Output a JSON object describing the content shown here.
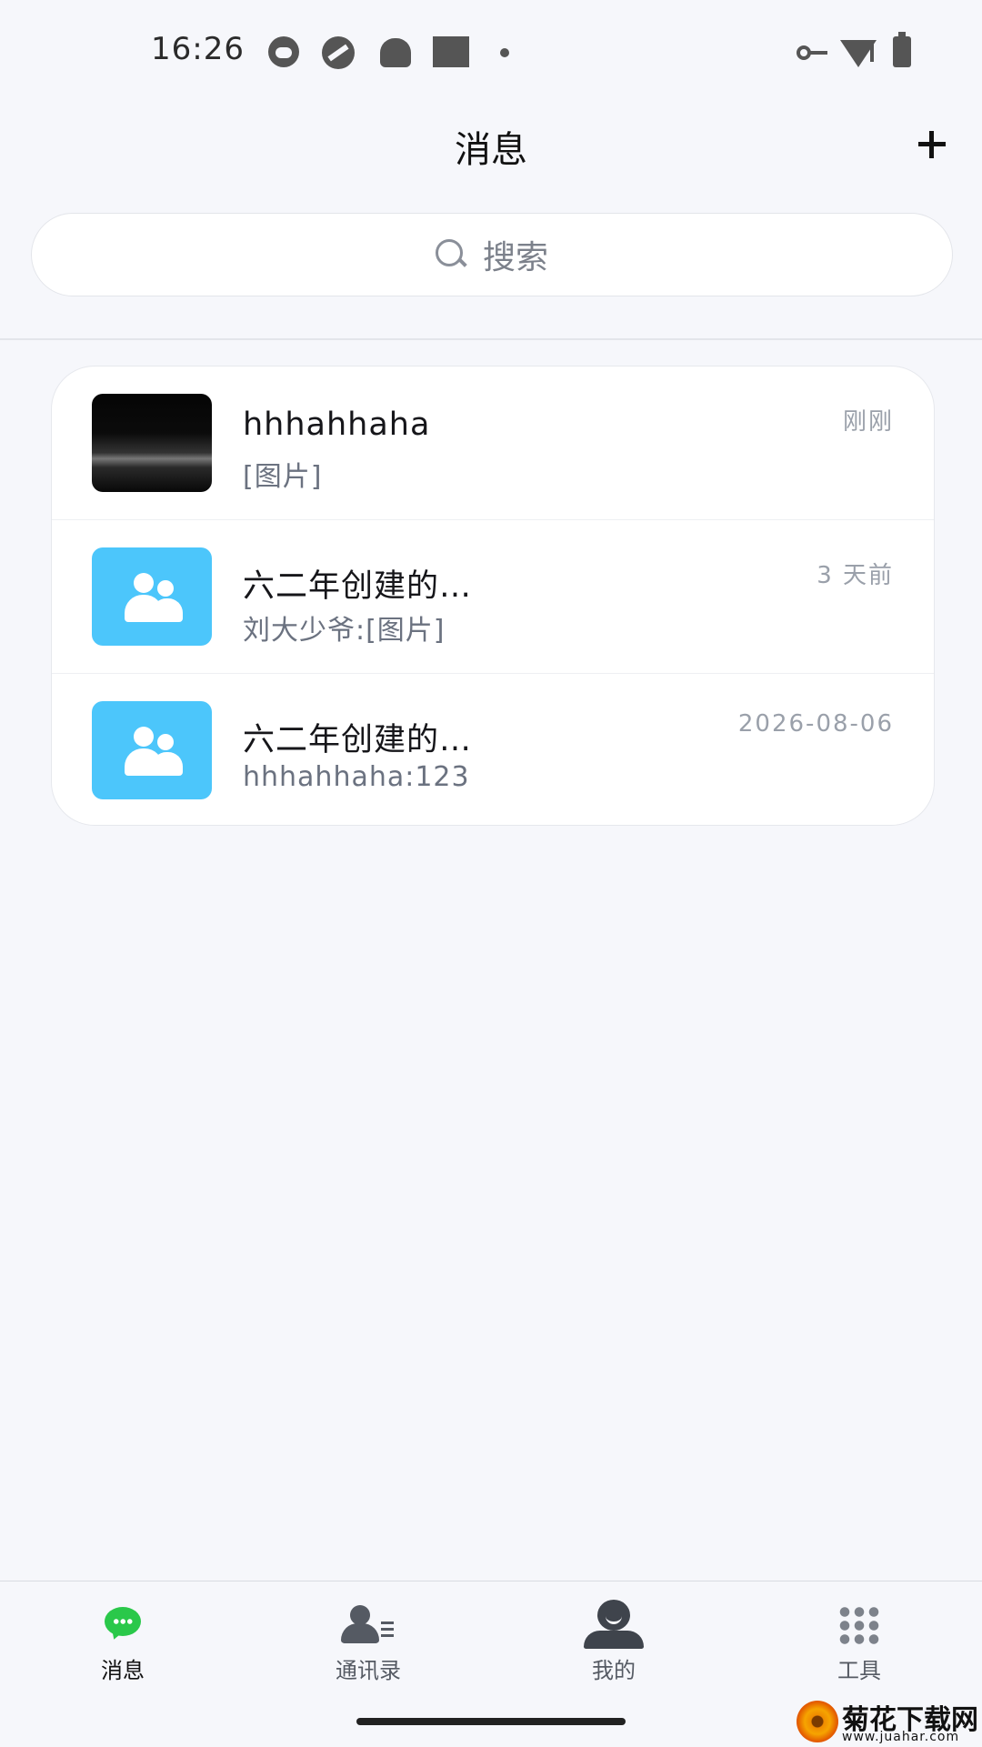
{
  "status_bar": {
    "time": "16:26",
    "icons": [
      "cat-icon",
      "aperture-icon",
      "android-icon",
      "square-icon",
      "dot-icon",
      "vpn-key-icon",
      "wifi-alert-icon",
      "battery-charging-icon"
    ]
  },
  "header": {
    "title": "消息",
    "add_label": "+"
  },
  "search": {
    "placeholder": "搜索"
  },
  "conversations": [
    {
      "name": "hhhahhaha",
      "preview": "[图片]",
      "time": "刚刚",
      "avatar": "photo"
    },
    {
      "name": "六二年创建的…",
      "preview": "刘大少爷:[图片]",
      "time": "3  天前",
      "avatar": "group-icon"
    },
    {
      "name": "六二年创建的…",
      "preview": "hhhahhaha:123",
      "time": "2026-08-06",
      "avatar": "group-icon"
    }
  ],
  "bottom_nav": {
    "items": [
      {
        "label": "消息",
        "icon": "chat-icon",
        "active": true
      },
      {
        "label": "通讯录",
        "icon": "contacts-icon",
        "active": false
      },
      {
        "label": "我的",
        "icon": "profile-icon",
        "active": false
      },
      {
        "label": "工具",
        "icon": "grid-icon",
        "active": false
      }
    ]
  },
  "colors": {
    "background": "#f6f7fb",
    "accent_green": "#2ac84a",
    "group_avatar": "#4cc6fb"
  },
  "watermark": {
    "text": "菊花下载网",
    "url": "www.juahar.com"
  }
}
